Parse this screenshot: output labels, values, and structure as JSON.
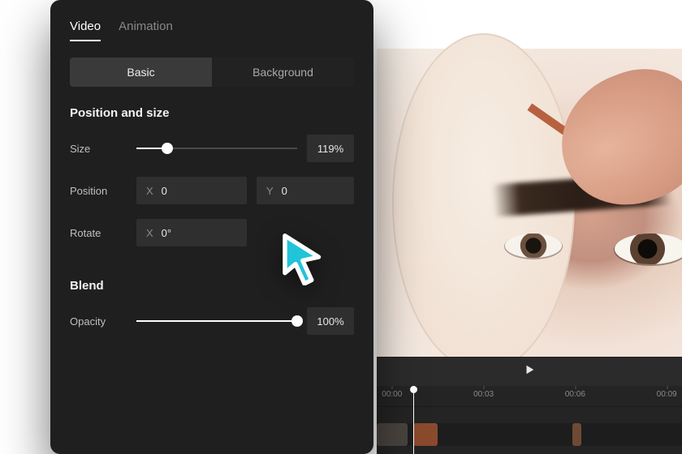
{
  "tabs": {
    "video": "Video",
    "animation": "Animation"
  },
  "subtabs": {
    "basic": "Basic",
    "background": "Background"
  },
  "sections": {
    "position_size": "Position and size",
    "blend": "Blend"
  },
  "controls": {
    "size_label": "Size",
    "size_value": "119%",
    "size_pct": 19,
    "position_label": "Position",
    "position_x_label": "X",
    "position_x_value": "0",
    "position_y_label": "Y",
    "position_y_value": "0",
    "rotate_label": "Rotate",
    "rotate_x_label": "X",
    "rotate_x_value": "0°",
    "opacity_label": "Opacity",
    "opacity_value": "100%",
    "opacity_pct": 100
  },
  "timeline": {
    "ticks": [
      "00:00",
      "00:03",
      "00:06",
      "00:09"
    ],
    "playhead_pct": 12,
    "clips": [
      {
        "left_pct": 0,
        "width_pct": 10,
        "color": "#4a4440"
      },
      {
        "left_pct": 12,
        "width_pct": 8,
        "color": "#8a4a2e"
      },
      {
        "left_pct": 64,
        "width_pct": 3,
        "color": "#6e4a35"
      }
    ]
  },
  "icons": {
    "play": "play-icon",
    "cursor": "cursor-pointer-icon"
  },
  "colors": {
    "panel_bg": "#1f1f1f",
    "accent_cursor": "#21c4d9"
  }
}
